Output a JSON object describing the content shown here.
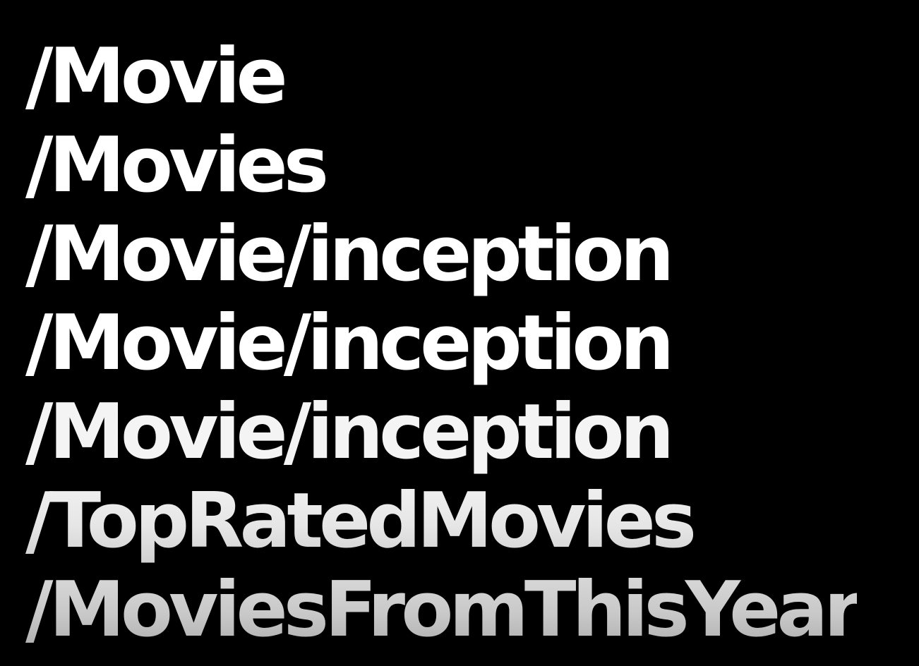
{
  "routes": [
    "/Movie",
    "/Movies",
    "/Movie/inception",
    "/Movie/inception",
    "/Movie/inception",
    "/TopRatedMovies",
    "/MoviesFromThisYear"
  ],
  "colors": {
    "background": "#000000",
    "text": "#ffffff",
    "text_faded": "#bdbdbd"
  }
}
